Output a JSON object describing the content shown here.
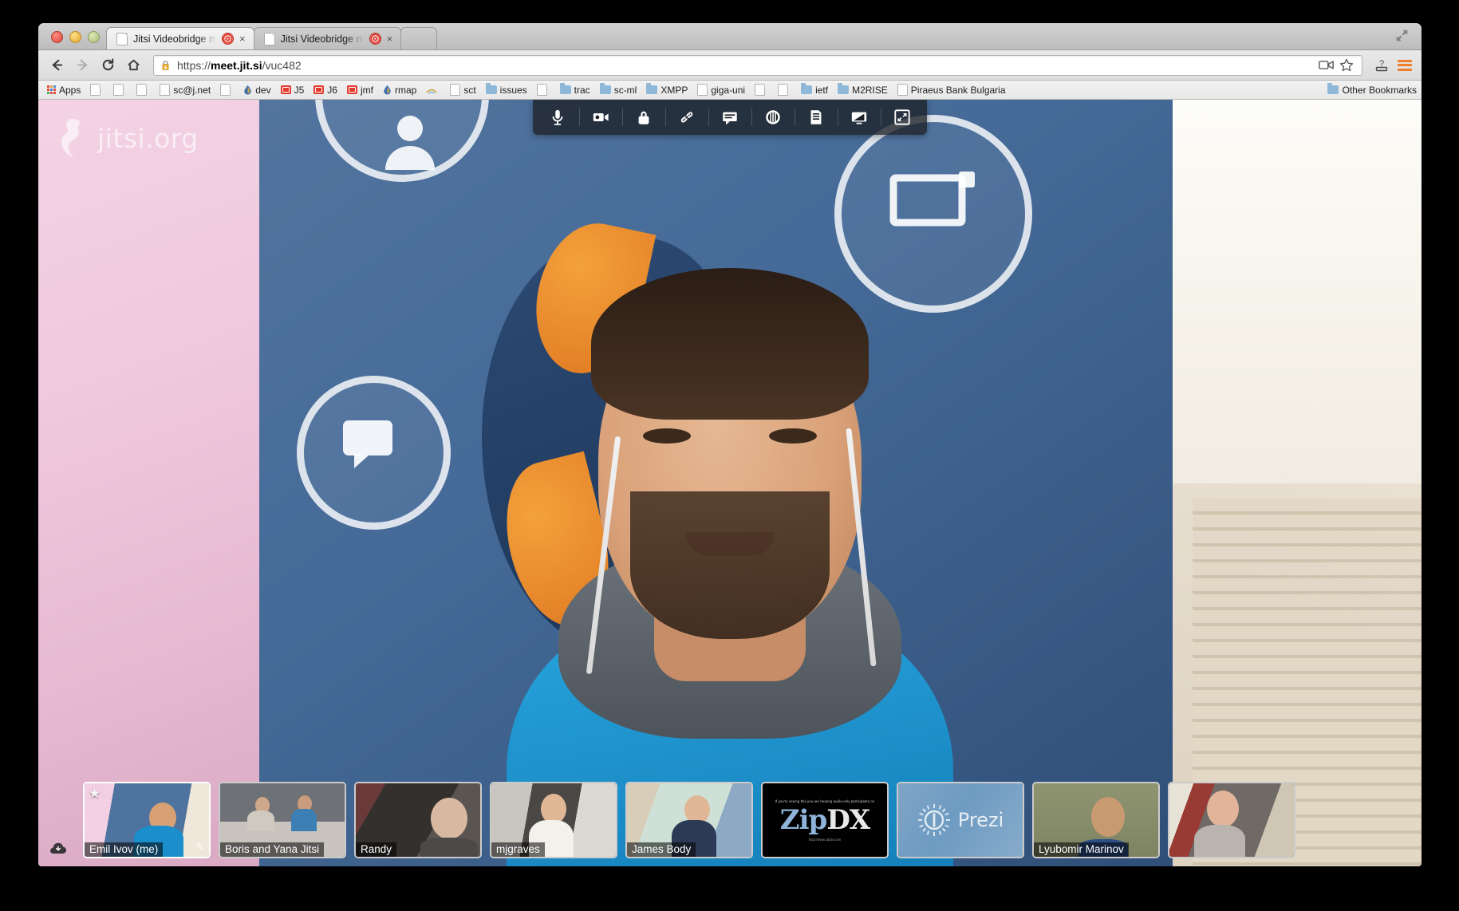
{
  "window": {
    "controls": [
      "close",
      "minimize",
      "zoom"
    ],
    "maximize_icon": "expand-arrows-icon"
  },
  "tabs": [
    {
      "title": "Jitsi Videobridge meets",
      "favicon": "page-icon",
      "recording_indicator": "record-dot-icon",
      "close": "×",
      "active": true
    },
    {
      "title": "Jitsi Videobridge meets",
      "favicon": "page-icon",
      "recording_indicator": "record-dot-icon",
      "close": "×",
      "active": false
    }
  ],
  "toolbar": {
    "back_label": "←",
    "forward_label": "→",
    "reload_label": "C",
    "home_label": "⌂",
    "url_prefix": "https://",
    "url_host": "meet.jit.si",
    "url_path": "/vuc482",
    "url_full": "https://meet.jit.si/vuc482",
    "security_icon": "warning-lock-icon",
    "cast_icon": "video-cast-icon",
    "bookmark_icon": "star-icon",
    "help_icon": "question-mark-icon",
    "menu_icon": "hamburger-menu-icon"
  },
  "bookmarks": {
    "apps_label": "Apps",
    "items": [
      {
        "label": "",
        "icon": "page-icon"
      },
      {
        "label": "",
        "icon": "page-icon"
      },
      {
        "label": "",
        "icon": "page-icon"
      },
      {
        "label": "sc@j.net",
        "icon": "page-icon"
      },
      {
        "label": "",
        "icon": "page-icon"
      },
      {
        "label": "dev",
        "icon": "drop-icon"
      },
      {
        "label": "J5",
        "icon": "red-square-icon"
      },
      {
        "label": "J6",
        "icon": "red-square-icon"
      },
      {
        "label": "jmf",
        "icon": "red-square-icon"
      },
      {
        "label": "rmap",
        "icon": "drop-icon"
      },
      {
        "label": "",
        "icon": "wifi-icon"
      },
      {
        "label": "sct",
        "icon": "page-icon"
      },
      {
        "label": "issues",
        "icon": "folder-icon"
      },
      {
        "label": "",
        "icon": "page-icon"
      },
      {
        "label": "trac",
        "icon": "folder-icon"
      },
      {
        "label": "sc-ml",
        "icon": "folder-icon"
      },
      {
        "label": "XMPP",
        "icon": "folder-icon"
      },
      {
        "label": "giga-uni",
        "icon": "page-icon"
      },
      {
        "label": "",
        "icon": "page-icon"
      },
      {
        "label": "",
        "icon": "page-icon"
      },
      {
        "label": "ietf",
        "icon": "folder-icon"
      },
      {
        "label": "M2RISE",
        "icon": "folder-icon"
      },
      {
        "label": "Piraeus Bank Bulgaria",
        "icon": "page-icon"
      }
    ],
    "other_bookmarks_label": "Other Bookmarks",
    "other_bookmarks_icon": "folder-icon"
  },
  "conference": {
    "watermark_text": "jitsi.org",
    "watermark_icon": "jitsi-logo-icon",
    "download_badge_icon": "cloud-download-icon",
    "toolbar_buttons": [
      {
        "name": "microphone-icon",
        "title": "Mute / unmute microphone"
      },
      {
        "name": "camera-icon",
        "title": "Start / stop camera"
      },
      {
        "name": "lock-icon",
        "title": "Lock room"
      },
      {
        "name": "link-icon",
        "title": "Invite link"
      },
      {
        "name": "chat-icon",
        "title": "Open chat"
      },
      {
        "name": "record-icon",
        "title": "Record"
      },
      {
        "name": "etherpad-icon",
        "title": "Shared document"
      },
      {
        "name": "screen-share-icon",
        "title": "Share screen"
      },
      {
        "name": "fullscreen-icon",
        "title": "Enter full screen"
      }
    ],
    "thumbnails": [
      {
        "name": "Emil Ivov (me)",
        "scene": "sc-emil",
        "dominant": true,
        "badges": [
          "star-icon",
          "pencil-icon"
        ]
      },
      {
        "name": "Boris and Yana Jitsi",
        "scene": "sc-boris",
        "dominant": false,
        "badges": []
      },
      {
        "name": "Randy",
        "scene": "sc-randy",
        "dominant": false,
        "badges": []
      },
      {
        "name": "mjgraves",
        "scene": "sc-mjgraves",
        "dominant": false,
        "badges": []
      },
      {
        "name": "James Body",
        "scene": "sc-james",
        "dominant": false,
        "badges": []
      },
      {
        "name": "",
        "scene": "sc-zipdx",
        "dominant": false,
        "badges": []
      },
      {
        "name": "",
        "scene": "sc-prezi",
        "dominant": false,
        "badges": []
      },
      {
        "name": "Lyubomir Marinov",
        "scene": "sc-lyubomir",
        "dominant": false,
        "badges": []
      },
      {
        "name": "",
        "scene": "sc-last",
        "dominant": false,
        "badges": []
      }
    ],
    "zipdx": {
      "tagline": "If you're seeing this you are hearing audio-only participants on",
      "logo_part_a": "Zip",
      "logo_part_b": "DX",
      "url": "http://www.zipdx.com"
    },
    "prezi": {
      "text": "Prezi",
      "icon": "prezi-sun-icon"
    }
  },
  "colors": {
    "accent_orange": "#f07d28",
    "jitsi_blue": "#1580bb",
    "record_red": "#e23b2e",
    "toolbar_bg": "rgba(28,32,38,.78)"
  }
}
